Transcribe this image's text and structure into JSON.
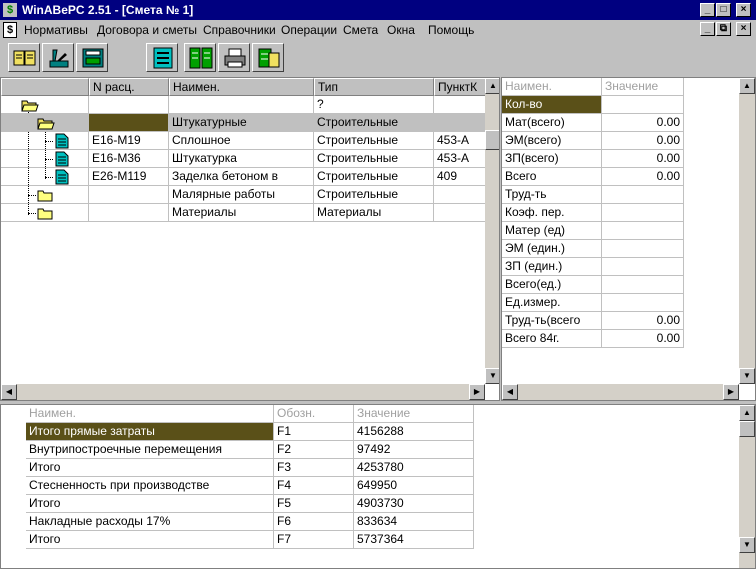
{
  "window": {
    "title": "WinABePC 2.51 - [Смета № 1]",
    "app_icon": "$",
    "minimize": "_",
    "maximize": "□",
    "close": "×"
  },
  "menu": {
    "doc_icon": "$",
    "items": [
      "Нормативы",
      "Договора и сметы",
      "Справочники",
      "Операции",
      "Смета",
      "Окна",
      "Помощь"
    ],
    "mdi_minimize": "_",
    "mdi_restore": "⧉",
    "mdi_close": "×"
  },
  "toolbar": {
    "buttons": [
      "book-icon",
      "knife-icon",
      "calculator-icon",
      "list-icon",
      "compare-icon",
      "printer-icon",
      "export-icon"
    ]
  },
  "tree_table": {
    "columns": [
      "",
      "N расц.",
      "Наимен.",
      "Тип",
      "ПунктК"
    ],
    "rows": [
      {
        "level": 0,
        "icon": "folder-open-icon",
        "code": "",
        "name": "",
        "type": "?",
        "punkt": ""
      },
      {
        "level": 1,
        "icon": "folder-open-icon",
        "code": "",
        "name": "Штукатурные",
        "type": "Строительные",
        "punkt": ""
      },
      {
        "level": 2,
        "icon": "document-icon",
        "code": "Е16-М19",
        "name": "Сплошное",
        "type": "Строительные",
        "punkt": "453-А"
      },
      {
        "level": 2,
        "icon": "document-icon",
        "code": "Е16-М36",
        "name": "Штукатурка",
        "type": "Строительные",
        "punkt": "453-А"
      },
      {
        "level": 2,
        "icon": "document-icon",
        "code": "Е26-М119",
        "name": "Заделка бетоном в",
        "type": "Строительные",
        "punkt": "409"
      },
      {
        "level": 1,
        "icon": "folder-icon",
        "code": "",
        "name": "Малярные работы",
        "type": "Строительные",
        "punkt": ""
      },
      {
        "level": 1,
        "icon": "folder-icon",
        "code": "",
        "name": "Материалы",
        "type": "Материалы",
        "punkt": ""
      }
    ]
  },
  "props_table": {
    "columns": [
      "Наимен.",
      "Значение"
    ],
    "rows": [
      {
        "name": "Кол-во",
        "value": ""
      },
      {
        "name": "Мат(всего)",
        "value": "0.00"
      },
      {
        "name": "ЭМ(всего)",
        "value": "0.00"
      },
      {
        "name": "ЗП(всего)",
        "value": "0.00"
      },
      {
        "name": "Всего",
        "value": "0.00"
      },
      {
        "name": "Труд-ть",
        "value": ""
      },
      {
        "name": "Коэф. пер.",
        "value": ""
      },
      {
        "name": "Матер (ед)",
        "value": ""
      },
      {
        "name": "ЭМ (един.)",
        "value": ""
      },
      {
        "name": "ЗП (един.)",
        "value": ""
      },
      {
        "name": "Всего(ед.)",
        "value": ""
      },
      {
        "name": "Ед.измер.",
        "value": ""
      },
      {
        "name": "Труд-ть(всего",
        "value": "0.00"
      },
      {
        "name": "Всего 84г.",
        "value": "0.00"
      }
    ]
  },
  "totals_table": {
    "columns": [
      "Наимен.",
      "Обозн.",
      "Значение"
    ],
    "rows": [
      {
        "name": "Итого прямые затраты",
        "code": "F1",
        "value": "4156288"
      },
      {
        "name": "Внутрипостроечные перемещения",
        "code": "F2",
        "value": "97492"
      },
      {
        "name": "Итого",
        "code": "F3",
        "value": "4253780"
      },
      {
        "name": "Стесненность при производстве",
        "code": "F4",
        "value": "649950"
      },
      {
        "name": "Итого",
        "code": "F5",
        "value": "4903730"
      },
      {
        "name": "Накладные расходы 17%",
        "code": "F6",
        "value": "833634"
      },
      {
        "name": "Итого",
        "code": "F7",
        "value": "5737364"
      }
    ]
  },
  "colors": {
    "titlebar": "#000080",
    "selection": "#5a5018",
    "face": "#c0c0c0"
  }
}
